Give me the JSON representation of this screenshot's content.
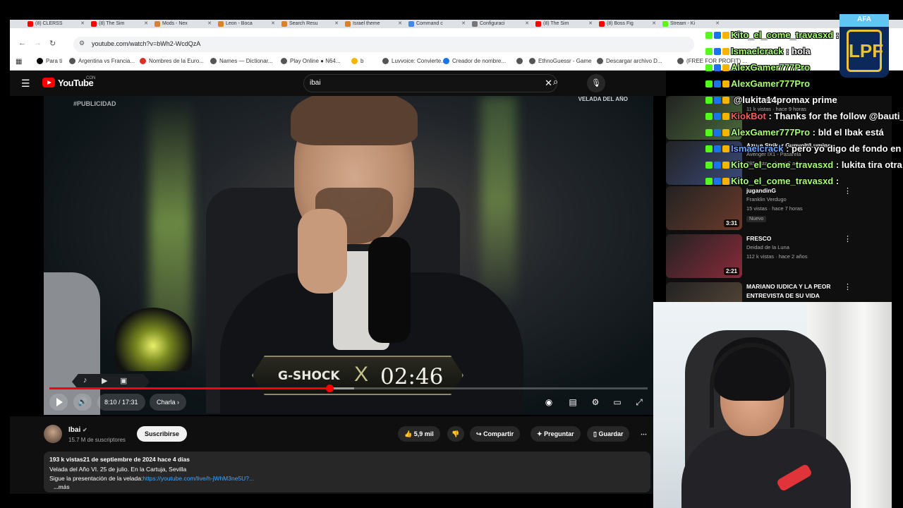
{
  "browser": {
    "tabs": [
      {
        "label": "(8) CLERSS",
        "color": "#ff0000"
      },
      {
        "label": "(8) The Sim",
        "color": "#ff0000"
      },
      {
        "label": "Mods - Nex",
        "color": "#d9822b"
      },
      {
        "label": "Leon - Boca",
        "color": "#d9822b"
      },
      {
        "label": "Search Resu",
        "color": "#d9822b"
      },
      {
        "label": "Israel theme",
        "color": "#d9822b"
      },
      {
        "label": "Command c",
        "color": "#4285f4"
      },
      {
        "label": "Configuraci",
        "color": "#777777"
      },
      {
        "label": "(8) The Sim",
        "color": "#ff0000"
      },
      {
        "label": "(8) Boss Fig",
        "color": "#ff0000"
      },
      {
        "label": "Stream - Ki",
        "color": "#53fc18"
      }
    ],
    "url": "youtube.com/watch?v=bWh2-WcdQzA",
    "bookmarks": [
      {
        "label": "Para ti",
        "icon": "x-icon",
        "color": "#000000"
      },
      {
        "label": "Argentina vs Francia...",
        "icon": "globe-icon",
        "color": "#555555"
      },
      {
        "label": "Nombres de la Euro...",
        "icon": "site-icon",
        "color": "#d93025"
      },
      {
        "label": "Names — Dictionar...",
        "icon": "globe-icon",
        "color": "#555555"
      },
      {
        "label": "Play Online ● N64...",
        "icon": "globe-icon",
        "color": "#555555"
      },
      {
        "label": "b",
        "icon": "emoji-icon",
        "color": "#f4b400"
      },
      {
        "label": "Luvvoice: Convierte...",
        "icon": "globe-icon",
        "color": "#555555"
      },
      {
        "label": "Creador de nombre...",
        "icon": "pen-icon",
        "color": "#1a73e8"
      },
      {
        "label": "",
        "icon": "globe-icon",
        "color": "#555555"
      },
      {
        "label": "EthnoGuessr - Game",
        "icon": "globe-icon",
        "color": "#555555"
      },
      {
        "label": "Descargar archivo D...",
        "icon": "globe-icon",
        "color": "#555555"
      },
      {
        "label": "(FREE FOR PROFIT) ...",
        "icon": "globe-icon",
        "color": "#555555"
      }
    ]
  },
  "youtube": {
    "logo_text": "YouTube",
    "logo_country": "CON",
    "search_value": "ibai",
    "video": {
      "tag": "#PUBLICIDAD",
      "corner_logo": "VELADA DEL AÑO",
      "banner_brand": "G-SHOCK",
      "banner_sep": "X",
      "banner_time": "02:46",
      "progress_fraction": 0.4683,
      "buffer_fraction": 0.51,
      "time_display": "8:10 / 17:31",
      "chapter_label": "Charla"
    },
    "channel": {
      "name": "Ibai",
      "subscribers": "15.7 M de suscriptores",
      "subscribe_label": "Suscribirse"
    },
    "actions": {
      "likes": "5,9 mil",
      "share": "Compartir",
      "ask": "Preguntar",
      "save": "Guardar"
    },
    "description": {
      "line1": "193 k vistas21 de septiembre de 2024  hace 4 días",
      "line2": "Velada del Año VI. 25 de julio. En la Cartuja, Sevilla",
      "line3_prefix": "Sigue la presentación de la velada:",
      "line3_link": "https://youtube.com/live/h-jWhM3ne5U?...",
      "more": "...más"
    }
  },
  "sidebar": {
    "items": [
      {
        "title": "#SI #SAYAGO",
        "channel": "",
        "stats": "11 k vistas · hace 9 horas",
        "duration": "",
        "thumb_color": "#4a6a3a",
        "badge": ""
      },
      {
        "title": "Azure Striker Gunvolt/Luminne",
        "channel": "Avenger IX1 - Pasarela",
        "stats": "285 vistas · hace 2 años",
        "duration": "",
        "thumb_color": "#3a4a7a",
        "badge": ""
      },
      {
        "title": "jugandinG",
        "channel": "Franklin Verdugo",
        "stats": "15 vistas · hace 7 horas",
        "duration": "3:31",
        "thumb_color": "#6a3a2a",
        "badge": "Nuevo"
      },
      {
        "title": "FRESCO",
        "channel": "Deidad de la Luna",
        "stats": "112 k vistas · hace 2 años",
        "duration": "2:21",
        "thumb_color": "#8a2a3a",
        "badge": ""
      },
      {
        "title": "MARIANO IUDICA Y LA PEOR ENTREVISTA DE SU VIDA",
        "channel": "",
        "stats": "",
        "duration": "",
        "thumb_color": "#5a4a3a",
        "badge": ""
      }
    ]
  },
  "chat": {
    "messages": [
      {
        "user": "Kito_el_come_travasxd",
        "text": ": a",
        "user_color": "#a6ff6f"
      },
      {
        "user": "Ismaelcrack",
        "text": ": hola",
        "user_color": "#a6ff6f"
      },
      {
        "user": "AlexGamer777Pro",
        "text": "",
        "user_color": "#a6ff6f"
      },
      {
        "user": "AlexGamer777Pro",
        "text": "",
        "user_color": "#a6ff6f"
      },
      {
        "user": "",
        "text": "@lukita14promax prime",
        "user_color": "#a6ff6f"
      },
      {
        "user": "KiokBot",
        "text": ": Thanks for the follow @bauti_l",
        "user_color": "#ff5a5a"
      },
      {
        "user": "AlexGamer777Pro",
        "text": ": bld el Ibak está",
        "user_color": "#a6ff6f"
      },
      {
        "user": "Ismaelcrack",
        "text": ": pero yo digo de fondo en e",
        "user_color": "#6fa6ff"
      },
      {
        "user": "Kito_el_come_travasxd",
        "text": ": lukita tira otra sul",
        "user_color": "#a6ff6f"
      },
      {
        "user": "Kito_el_come_travasxd",
        "text": ":",
        "user_color": "#a6ff6f"
      }
    ]
  },
  "overlay": {
    "league_top": "AFA",
    "league_mark": "LPF"
  }
}
